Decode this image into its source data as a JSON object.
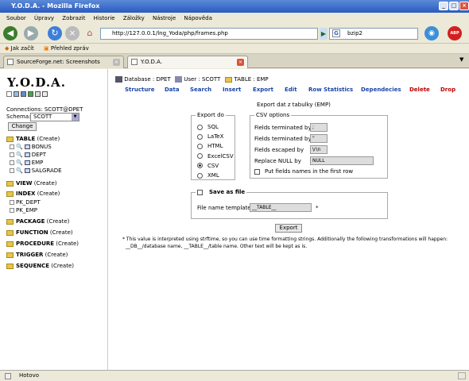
{
  "window": {
    "title": "Y.O.D.A. - Mozilla Firefox"
  },
  "menu": [
    "Soubor",
    "Úpravy",
    "Zobrazit",
    "Historie",
    "Záložky",
    "Nástroje",
    "Nápověda"
  ],
  "nav": {
    "url": "http://127.0.0.1/lng_Yoda/php/frames.php",
    "search_value": "bzip2",
    "search_engine": "G"
  },
  "bookmarks": [
    "Jak začít",
    "Přehled zpráv"
  ],
  "tabs": [
    {
      "label": "SourceForge.net: Screenshots"
    },
    {
      "label": "Y.O.D.A."
    }
  ],
  "sidebar": {
    "logo": "Y.O.D.A.",
    "connections": "Connections: SCOTT@DPET",
    "schema_label": "Schema:",
    "schema_value": "SCOTT",
    "change": "Change",
    "table": "TABLE",
    "tables": [
      "BONUS",
      "DEPT",
      "EMP",
      "SALGRADE"
    ],
    "view": "VIEW",
    "index": "INDEX",
    "indexes": [
      "PK_DEPT",
      "PK_EMP"
    ],
    "package": "PACKAGE",
    "function": "FUNCTION",
    "procedure": "PROCEDURE",
    "trigger": "TRIGGER",
    "sequence": "SEQUENCE",
    "create": "(Create)"
  },
  "main": {
    "breadcrumb": {
      "database": "Database : DPET",
      "user": "User : SCOTT",
      "table": "TABLE : EMP"
    },
    "tabs": [
      "Structure",
      "Data",
      "Search",
      "Insert",
      "Export",
      "Edit",
      "Row Statistics",
      "Dependecies",
      "Delete",
      "Drop"
    ],
    "heading": "Export dat z tabulky (EMP)",
    "export_do": {
      "legend": "Export do",
      "options": [
        "SQL",
        "LaTeX",
        "HTML",
        "ExcelCSV",
        "CSV",
        "XML"
      ],
      "selected": "CSV"
    },
    "csv": {
      "legend": "CSV options",
      "rows": [
        {
          "label": "Fields terminated by",
          "value": ";"
        },
        {
          "label": "Fields terminated by",
          "value": "\""
        },
        {
          "label": "Fields escaped by",
          "value": "\\r\\n"
        },
        {
          "label": "Replace NULL by",
          "value": "NULL"
        }
      ],
      "put_names": "Put fields names in the first row"
    },
    "save": {
      "label": "Save as file",
      "template_label": "File name template :",
      "template_value": "__TABLE__",
      "asterisk": "*"
    },
    "export_button": "Export",
    "note_line1": "* This value is interpreted using strftime, so you can use time formatting strings. Additionally the following transformations will happen:",
    "note_line2": "__DB__/database name, __TABLE__/table name. Other text will be kept as is."
  },
  "status": "Hotovo",
  "colors": {
    "accent": "#1a45a8",
    "titlebar": "#2a5bc0",
    "delete": "#c00000"
  }
}
